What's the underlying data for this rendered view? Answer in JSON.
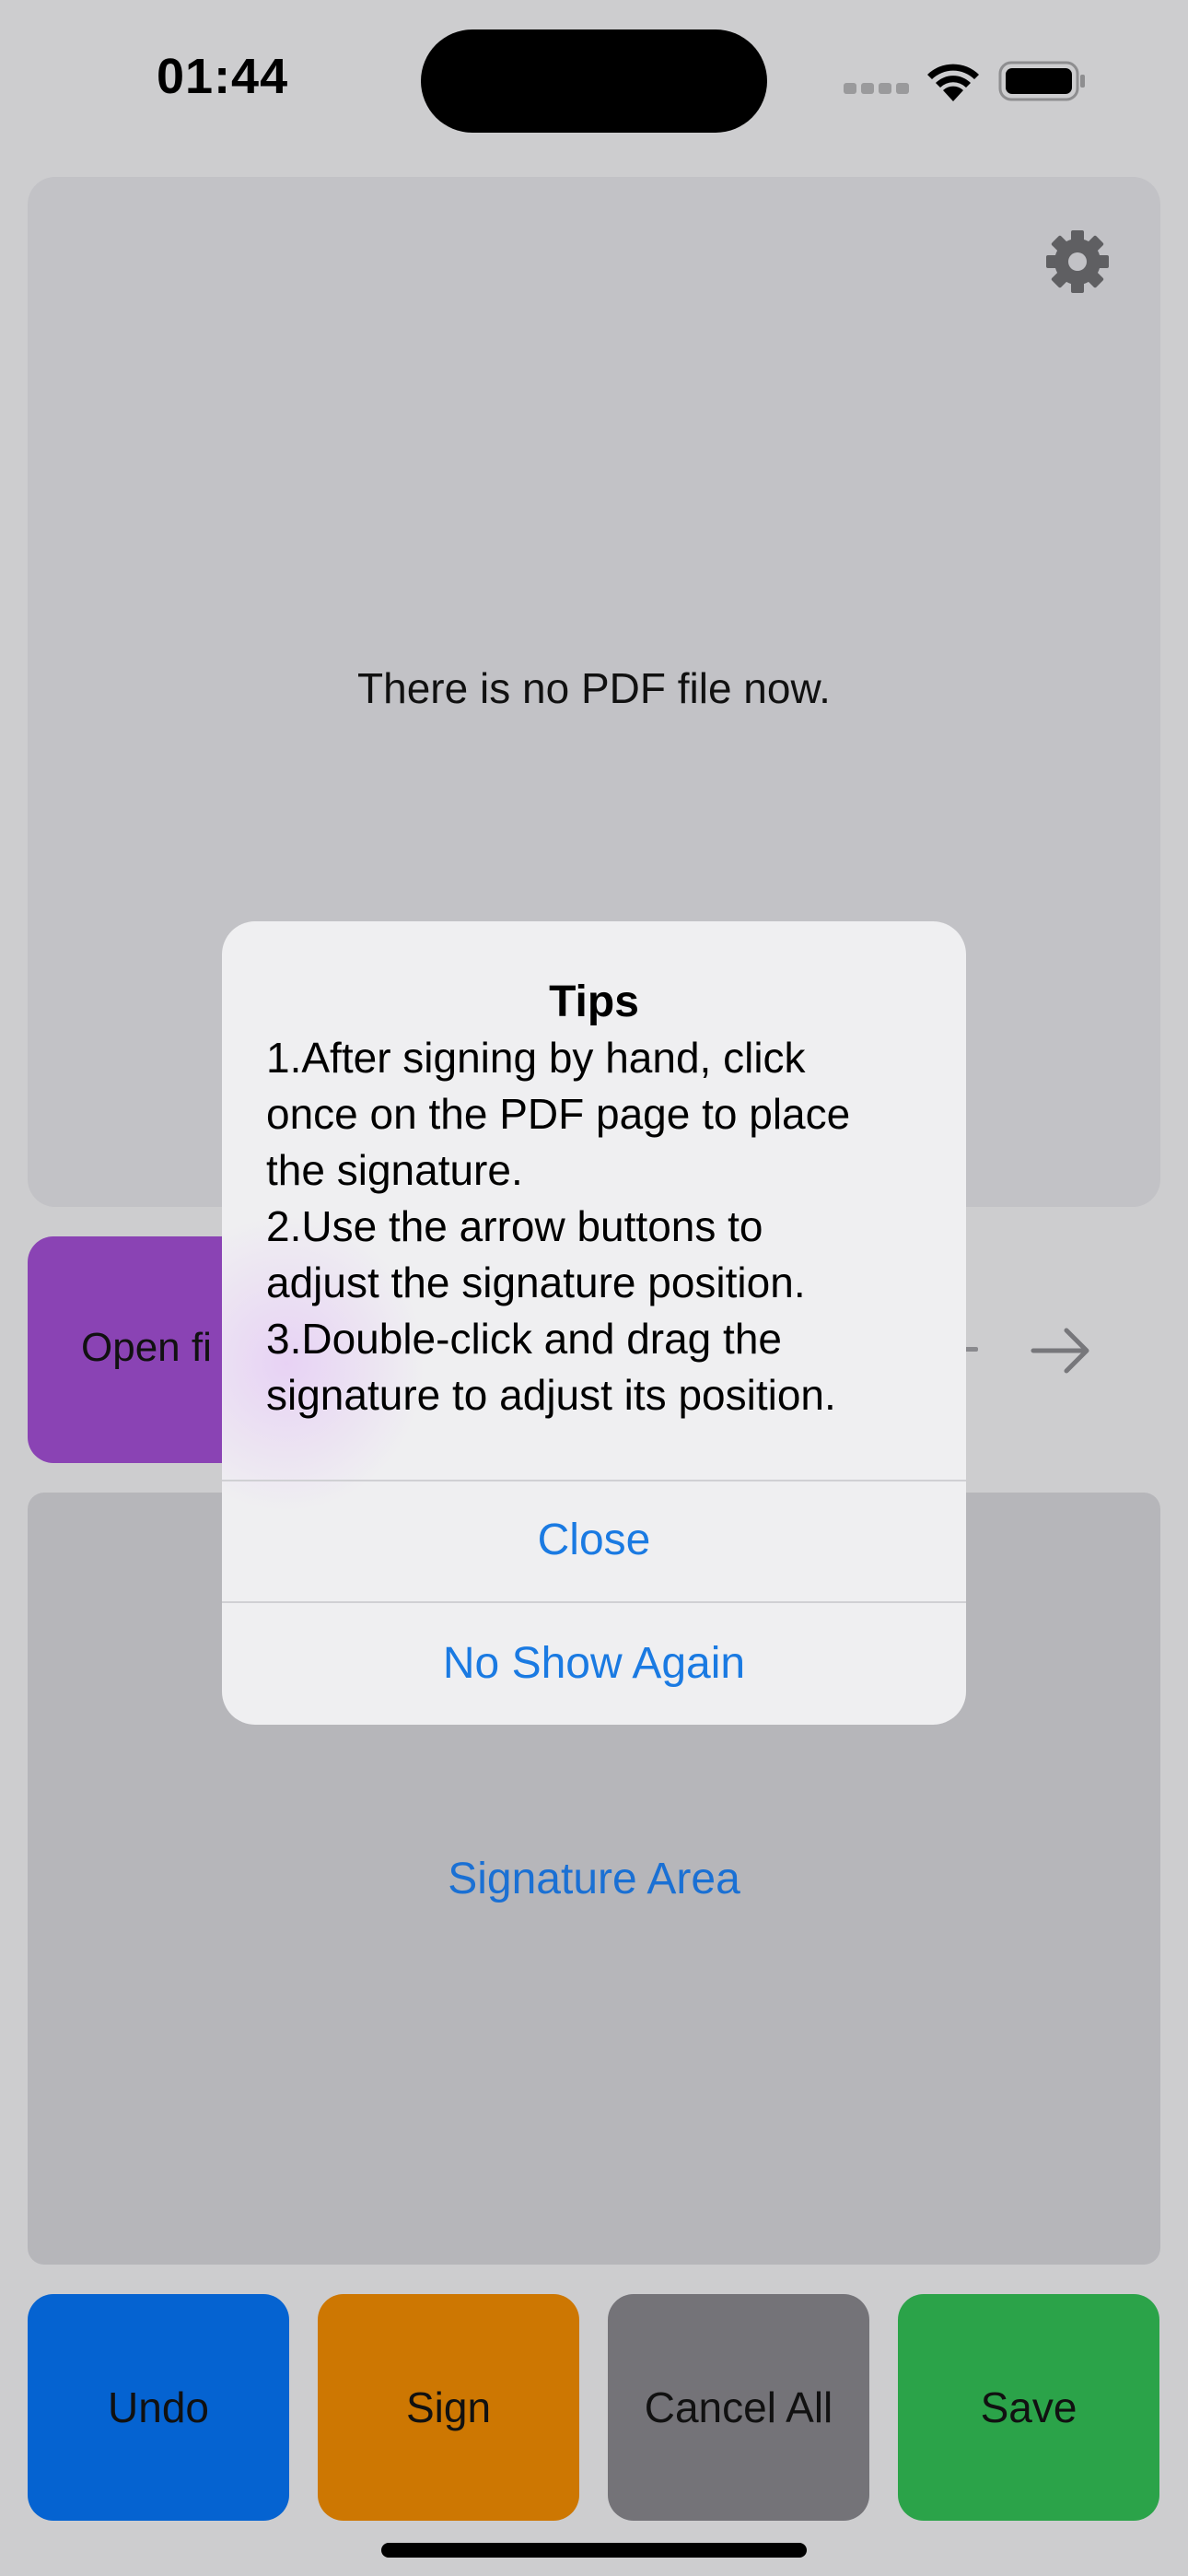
{
  "status_bar": {
    "time": "01:44"
  },
  "viewer": {
    "empty_message": "There is no PDF file now.",
    "settings_icon": "gear-icon"
  },
  "toolbar": {
    "open_file_label": "Open fi",
    "next_icon": "arrow-right-icon"
  },
  "signature_area": {
    "label": "Signature Area"
  },
  "actions": {
    "undo": "Undo",
    "sign": "Sign",
    "cancel_all": "Cancel All",
    "save": "Save"
  },
  "alert": {
    "title": "Tips",
    "message_lines": [
      "1.After signing by hand, click",
      "once on the PDF page to place",
      "the signature.",
      "2.Use the arrow buttons to",
      "adjust the signature position.",
      "3.Double-click and drag the",
      "signature to adjust its position."
    ],
    "close_label": "Close",
    "no_show_label": "No Show Again"
  },
  "colors": {
    "open_file": "#8a43b4",
    "undo": "#0563d1",
    "sign": "#cd7702",
    "cancel_all": "#747378",
    "save": "#2ba349",
    "link": "#1a7ae2"
  }
}
